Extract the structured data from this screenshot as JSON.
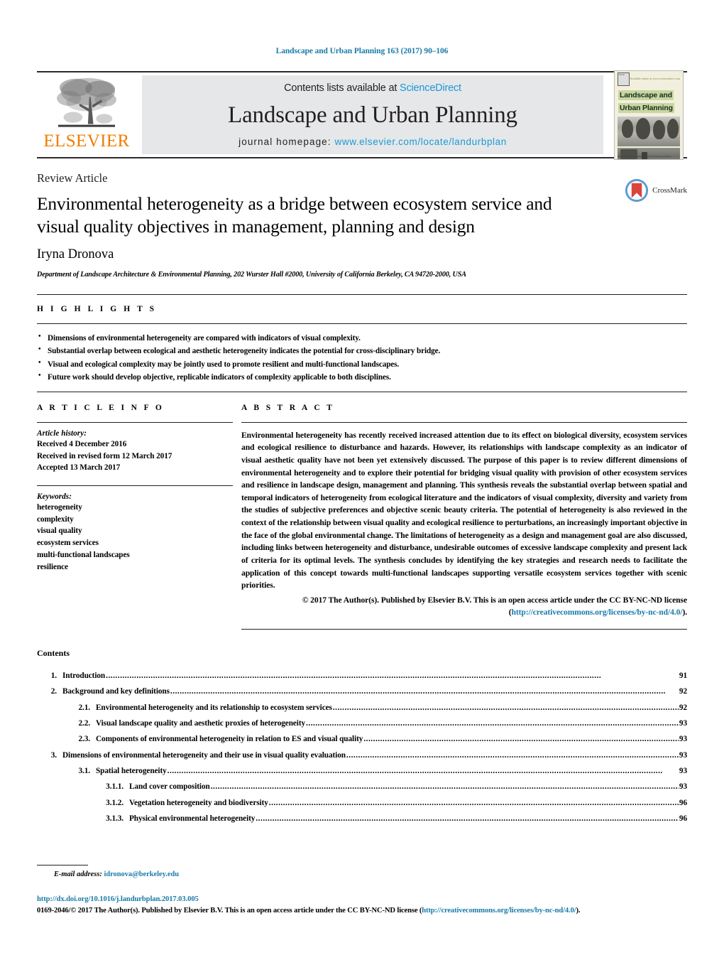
{
  "running_head": "Landscape and Urban Planning 163 (2017) 90–106",
  "masthead": {
    "publisher_name": "ELSEVIER",
    "contents_prefix": "Contents lists available at ",
    "sciencedirect": "ScienceDirect",
    "journal_title": "Landscape and Urban Planning",
    "homepage_prefix": "journal homepage: ",
    "homepage_url": "www.elsevier.com/locate/landurbplan",
    "cover": {
      "title_line1": "Landscape and",
      "title_line2": "Urban Planning",
      "badge_text": "IALE",
      "top_right_text": "Available online at www.sciencedirect.com",
      "footer_text": "ELSEVIER  An International Journal of Landscape Science"
    },
    "accent_orange": "#ef7d00",
    "accent_blue": "#1a9ad7",
    "panel_gray": "#e6e7e8"
  },
  "article": {
    "type_label": "Review Article",
    "title": "Environmental heterogeneity as a bridge between ecosystem service and visual quality objectives in management, planning and design",
    "authors": "Iryna Dronova",
    "affiliation": "Department of Landscape Architecture & Environmental Planning, 202 Wurster Hall #2000, University of California Berkeley, CA 94720-2000, USA",
    "crossmark_label": "CrossMark"
  },
  "highlights": {
    "heading": "H I G H L I G H T S",
    "items": [
      "Dimensions of environmental heterogeneity are compared with indicators of visual complexity.",
      "Substantial overlap between ecological and aesthetic heterogeneity indicates the potential for cross-disciplinary bridge.",
      "Visual and ecological complexity may be jointly used to promote resilient and multi-functional landscapes.",
      "Future work should develop objective, replicable indicators of complexity applicable to both disciplines."
    ]
  },
  "article_info": {
    "heading": "A R T I C L E  I N F O",
    "history_label": "Article history:",
    "history": [
      "Received 4 December 2016",
      "Received in revised form 12 March 2017",
      "Accepted 13 March 2017"
    ],
    "keywords_label": "Keywords:",
    "keywords": [
      "heterogeneity",
      "complexity",
      "visual quality",
      "ecosystem services",
      "multi-functional landscapes",
      "resilience"
    ]
  },
  "abstract": {
    "heading": "A B S T R A C T",
    "body": "Environmental heterogeneity has recently received increased attention due to its effect on biological diversity, ecosystem services and ecological resilience to disturbance and hazards. However, its relationships with landscape complexity as an indicator of visual aesthetic quality have not been yet extensively discussed. The purpose of this paper is to review different dimensions of environmental heterogeneity and to explore their potential for bridging visual quality with provision of other ecosystem services and resilience in landscape design, management and planning. This synthesis reveals the substantial overlap between spatial and temporal indicators of heterogeneity from ecological literature and the indicators of visual complexity, diversity and variety from the studies of subjective preferences and objective scenic beauty criteria. The potential of heterogeneity is also reviewed in the context of the relationship between visual quality and ecological resilience to perturbations, an increasingly important objective in the face of the global environmental change. The limitations of heterogeneity as a design and management goal are also discussed, including links between heterogeneity and disturbance, undesirable outcomes of excessive landscape complexity and present lack of criteria for its optimal levels. The synthesis concludes by identifying the key strategies and research needs to facilitate the application of this concept towards multi-functional landscapes supporting versatile ecosystem services together with scenic priorities.",
    "copyright_text": "© 2017 The Author(s). Published by Elsevier B.V. This is an open access article under the CC BY-NC-ND license (",
    "license_url": "http://creativecommons.org/licenses/by-nc-nd/4.0/",
    "copyright_suffix": ")."
  },
  "contents": {
    "title": "Contents",
    "entries": [
      {
        "num": "1.",
        "label": "Introduction",
        "page": "91",
        "level": 1
      },
      {
        "num": "2.",
        "label": "Background and key definitions",
        "page": "92",
        "level": 1
      },
      {
        "num": "2.1.",
        "label": "Environmental heterogeneity and its relationship to ecosystem services",
        "page": "92",
        "level": 2
      },
      {
        "num": "2.2.",
        "label": "Visual landscape quality and aesthetic proxies of heterogeneity",
        "page": "93",
        "level": 2
      },
      {
        "num": "2.3.",
        "label": "Components of environmental heterogeneity in relation to ES and visual quality",
        "page": "93",
        "level": 2
      },
      {
        "num": "3.",
        "label": "Dimensions of environmental heterogeneity and their use in visual quality evaluation",
        "page": "93",
        "level": 1
      },
      {
        "num": "3.1.",
        "label": "Spatial heterogeneity",
        "page": "93",
        "level": 2
      },
      {
        "num": "3.1.1.",
        "label": "Land cover composition",
        "page": "93",
        "level": 3
      },
      {
        "num": "3.1.2.",
        "label": "Vegetation heterogeneity and biodiversity",
        "page": "96",
        "level": 3
      },
      {
        "num": "3.1.3.",
        "label": "Physical environmental heterogeneity",
        "page": "96",
        "level": 3
      }
    ]
  },
  "footer": {
    "email_label": "E-mail address:",
    "email": "idronova@berkeley.edu",
    "doi_url": "http://dx.doi.org/10.1016/j.landurbplan.2017.03.005",
    "issn_copyright": "0169-2046/© 2017 The Author(s). Published by Elsevier B.V. This is an open access article under the CC BY-NC-ND license (",
    "license_url_a": "http://creativecommons.org/licenses/by-nc-nd/",
    "license_url_b": "4.0/",
    "copyright_suffix": ")."
  }
}
